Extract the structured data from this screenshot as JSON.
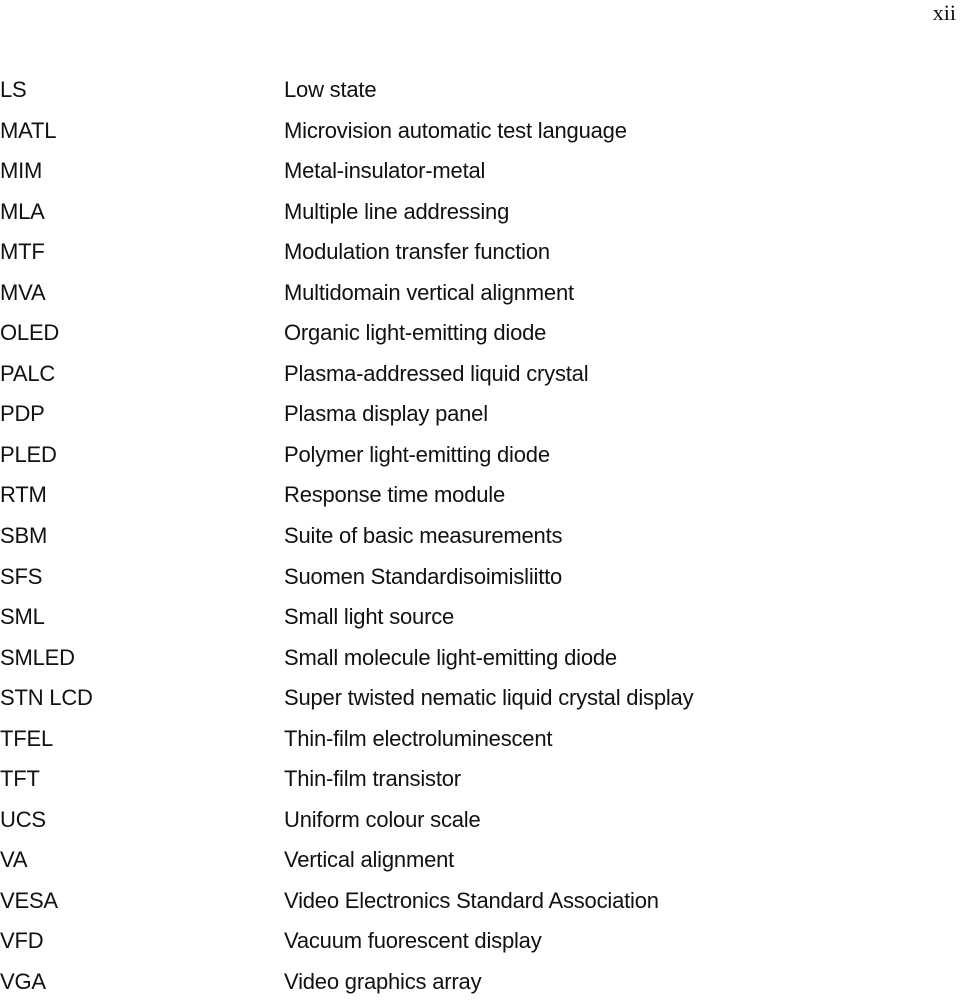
{
  "page": {
    "number": "xii"
  },
  "abbreviations": [
    {
      "term": "LS",
      "definition": "Low state"
    },
    {
      "term": "MATL",
      "definition": "Microvision automatic test language"
    },
    {
      "term": "MIM",
      "definition": "Metal-insulator-metal"
    },
    {
      "term": "MLA",
      "definition": "Multiple line addressing"
    },
    {
      "term": "MTF",
      "definition": "Modulation transfer function"
    },
    {
      "term": "MVA",
      "definition": "Multidomain vertical alignment"
    },
    {
      "term": "OLED",
      "definition": "Organic light-emitting diode"
    },
    {
      "term": "PALC",
      "definition": "Plasma-addressed liquid crystal"
    },
    {
      "term": "PDP",
      "definition": "Plasma display panel"
    },
    {
      "term": "PLED",
      "definition": "Polymer light-emitting diode"
    },
    {
      "term": "RTM",
      "definition": "Response time module"
    },
    {
      "term": "SBM",
      "definition": "Suite of basic measurements"
    },
    {
      "term": "SFS",
      "definition": "Suomen Standardisoimisliitto"
    },
    {
      "term": "SML",
      "definition": "Small light source"
    },
    {
      "term": "SMLED",
      "definition": "Small molecule light-emitting diode"
    },
    {
      "term": "STN LCD",
      "definition": "Super twisted nematic liquid crystal display"
    },
    {
      "term": "TFEL",
      "definition": "Thin-film electroluminescent"
    },
    {
      "term": "TFT",
      "definition": "Thin-film transistor"
    },
    {
      "term": "UCS",
      "definition": "Uniform colour scale"
    },
    {
      "term": "VA",
      "definition": "Vertical alignment"
    },
    {
      "term": "VESA",
      "definition": "Video Electronics Standard Association"
    },
    {
      "term": "VFD",
      "definition": "Vacuum fuorescent display"
    },
    {
      "term": "VGA",
      "definition": "Video graphics array"
    }
  ]
}
